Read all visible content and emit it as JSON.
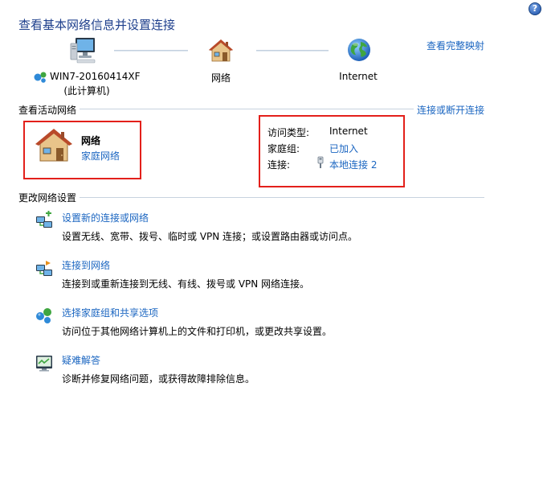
{
  "header": {
    "title": "查看基本网络信息并设置连接",
    "help_glyph": "?",
    "full_map_link": "查看完整映射"
  },
  "network_map": {
    "computer_name": "WIN7-20160414XF",
    "computer_sub": "(此计算机)",
    "network_label": "网络",
    "internet_label": "Internet"
  },
  "active_networks": {
    "section_title": "查看活动网络",
    "connect_link": "连接或断开连接",
    "network_name": "网络",
    "network_type": "家庭网络",
    "access_type_label": "访问类型:",
    "access_type_value": "Internet",
    "homegroup_label": "家庭组:",
    "homegroup_value": "已加入",
    "connection_label": "连接:",
    "connection_value": "本地连接 2"
  },
  "change_settings": {
    "section_title": "更改网络设置",
    "tasks": [
      {
        "title": "设置新的连接或网络",
        "desc": "设置无线、宽带、拨号、临时或 VPN 连接；或设置路由器或访问点。"
      },
      {
        "title": "连接到网络",
        "desc": "连接到或重新连接到无线、有线、拨号或 VPN 网络连接。"
      },
      {
        "title": "选择家庭组和共享选项",
        "desc": "访问位于其他网络计算机上的文件和打印机，或更改共享设置。"
      },
      {
        "title": "疑难解答",
        "desc": "诊断并修复网络问题，或获得故障排除信息。"
      }
    ]
  },
  "colors": {
    "link": "#1b66c1",
    "title": "#1e3f8c",
    "highlight_box": "#e3201b"
  }
}
